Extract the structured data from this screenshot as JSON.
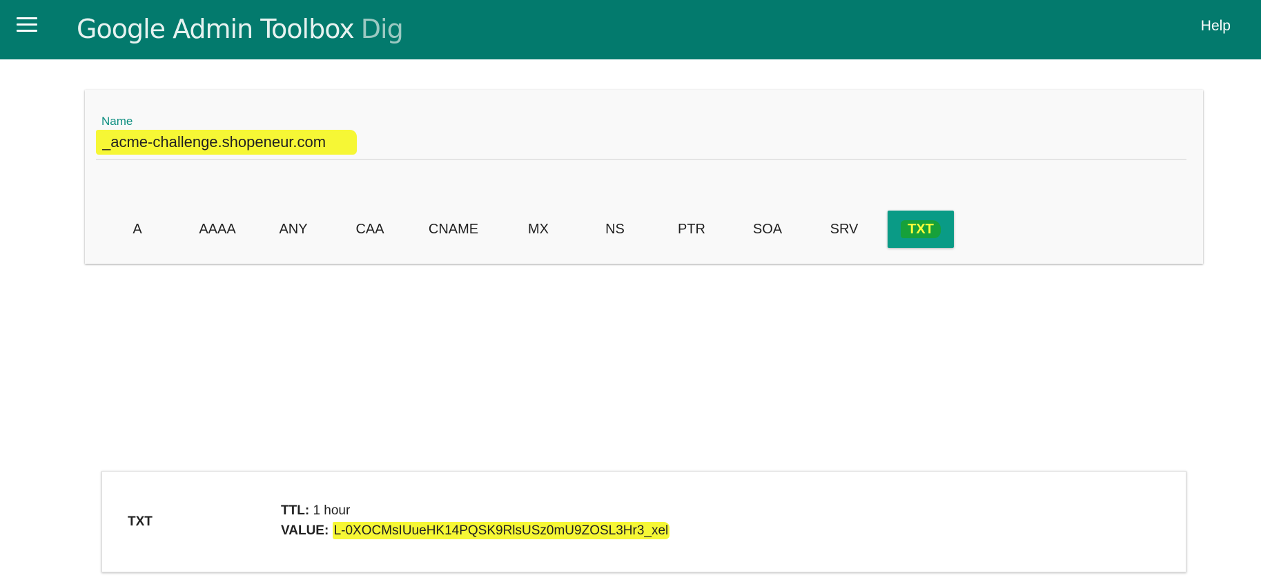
{
  "header": {
    "product": "Google Admin Toolbox",
    "tool": "Dig",
    "help_label": "Help",
    "menu_icon": "hamburger-menu-icon"
  },
  "query": {
    "name_label": "Name",
    "name_value": "_acme-challenge.shopeneur.com",
    "record_types": [
      "A",
      "AAAA",
      "ANY",
      "CAA",
      "CNAME",
      "MX",
      "NS",
      "PTR",
      "SOA",
      "SRV",
      "TXT"
    ],
    "selected_type": "TXT"
  },
  "result": {
    "type": "TXT",
    "ttl_label": "TTL:",
    "ttl_value": "1 hour",
    "value_label": "VALUE:",
    "value": "L-0XOCMsIUueHK14PQSK9RlsUSz0mU9ZOSL3Hr3_xel"
  },
  "colors": {
    "header_bg": "#037a6d",
    "accent": "#0e8f80",
    "highlight_yellow": "#f6f735",
    "selected_button": "#0a9b86"
  }
}
